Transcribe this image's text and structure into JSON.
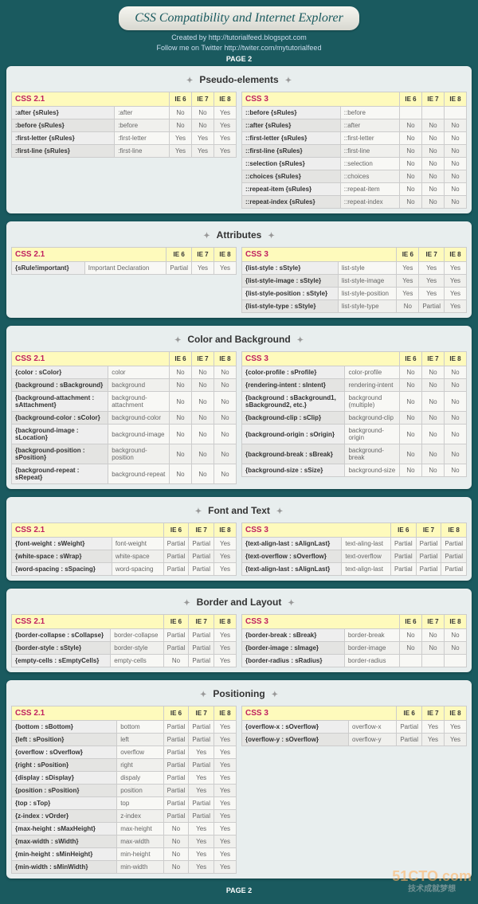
{
  "header": {
    "title": "CSS Compatibility and Internet Explorer",
    "created": "Created by http://tutorialfeed.blogspot.com",
    "follow": "Follow me on Twitter http://twiter.com/mytutorialfeed",
    "page": "PAGE 2"
  },
  "watermark": {
    "brand": "51CTO.com",
    "tag": "技术成就梦想"
  },
  "sections": [
    {
      "title": "Pseudo-elements",
      "left": {
        "spec": "CSS 2.1",
        "cols": [
          "IE 6",
          "IE 7",
          "IE 8"
        ],
        "rows": [
          {
            "a": ":after {sRules}",
            "b": ":after",
            "v": [
              "No",
              "No",
              "Yes"
            ]
          },
          {
            "a": ":before {sRules}",
            "b": ":before",
            "v": [
              "No",
              "No",
              "Yes"
            ]
          },
          {
            "a": ":first-letter {sRules}",
            "b": ":first-letter",
            "v": [
              "Yes",
              "Yes",
              "Yes"
            ]
          },
          {
            "a": ":first-line {sRules}",
            "b": ":first-line",
            "v": [
              "Yes",
              "Yes",
              "Yes"
            ]
          }
        ]
      },
      "right": {
        "spec": "CSS 3",
        "cols": [
          "IE 6",
          "IE 7",
          "IE 8"
        ],
        "rows": [
          {
            "a": "::before {sRules}",
            "b": "::before",
            "v": [
              "",
              "",
              ""
            ]
          },
          {
            "a": "::after {sRules}",
            "b": "::after",
            "v": [
              "No",
              "No",
              "No"
            ]
          },
          {
            "a": "::first-letter {sRules}",
            "b": "::first-letter",
            "v": [
              "No",
              "No",
              "No"
            ]
          },
          {
            "a": "::first-line {sRules}",
            "b": "::first-line",
            "v": [
              "No",
              "No",
              "No"
            ]
          },
          {
            "a": "::selection {sRules}",
            "b": "::selection",
            "v": [
              "No",
              "No",
              "No"
            ]
          },
          {
            "a": "::choices {sRules}",
            "b": "::choices",
            "v": [
              "No",
              "No",
              "No"
            ]
          },
          {
            "a": "::repeat-item {sRules}",
            "b": "::repeat-item",
            "v": [
              "No",
              "No",
              "No"
            ]
          },
          {
            "a": "::repeat-index {sRules}",
            "b": "::repeat-index",
            "v": [
              "No",
              "No",
              "No"
            ]
          }
        ]
      }
    },
    {
      "title": "Attributes",
      "left": {
        "spec": "CSS 2.1",
        "cols": [
          "IE 6",
          "IE 7",
          "IE 8"
        ],
        "rows": [
          {
            "a": "{sRule!important}",
            "b": "Important Declaration",
            "v": [
              "Partial",
              "Yes",
              "Yes"
            ]
          }
        ]
      },
      "right": {
        "spec": "CSS 3",
        "cols": [
          "IE 6",
          "IE 7",
          "IE 8"
        ],
        "rows": [
          {
            "a": "{list-style : sStyle}",
            "b": "list-style",
            "v": [
              "Yes",
              "Yes",
              "Yes"
            ]
          },
          {
            "a": "{list-style-image : sStyle}",
            "b": "list-style-image",
            "v": [
              "Yes",
              "Yes",
              "Yes"
            ]
          },
          {
            "a": "{list-style-position : sStyle}",
            "b": "list-style-position",
            "v": [
              "Yes",
              "Yes",
              "Yes"
            ]
          },
          {
            "a": "{list-style-type : sStyle}",
            "b": "list-style-type",
            "v": [
              "No",
              "Partial",
              "Yes"
            ]
          }
        ]
      }
    },
    {
      "title": "Color and Background",
      "left": {
        "spec": "CSS 2.1",
        "cols": [
          "IE 6",
          "IE 7",
          "IE 8"
        ],
        "rows": [
          {
            "a": "{color : sColor}",
            "b": "color",
            "v": [
              "No",
              "No",
              "No"
            ]
          },
          {
            "a": "{background : sBackground}",
            "b": "background",
            "v": [
              "No",
              "No",
              "No"
            ]
          },
          {
            "a": "{background-attachment : sAttachment}",
            "b": "background-attachment",
            "v": [
              "No",
              "No",
              "No"
            ]
          },
          {
            "a": "{background-color : sColor}",
            "b": "background-color",
            "v": [
              "No",
              "No",
              "No"
            ]
          },
          {
            "a": "{background-image : sLocation}",
            "b": "background-image",
            "v": [
              "No",
              "No",
              "No"
            ]
          },
          {
            "a": "{background-position : sPosition}",
            "b": "background-position",
            "v": [
              "No",
              "No",
              "No"
            ]
          },
          {
            "a": "{background-repeat : sRepeat}",
            "b": "background-repeat",
            "v": [
              "No",
              "No",
              "No"
            ]
          }
        ]
      },
      "right": {
        "spec": "CSS 3",
        "cols": [
          "IE 6",
          "IE 7",
          "IE 8"
        ],
        "rows": [
          {
            "a": "{color-profile : sProfile}",
            "b": "color-profile",
            "v": [
              "No",
              "No",
              "No"
            ]
          },
          {
            "a": "{rendering-intent : sIntent}",
            "b": "rendering-intent",
            "v": [
              "No",
              "No",
              "No"
            ]
          },
          {
            "a": "{background : sBackground1, sBackground2, etc.}",
            "b": "background (multiple)",
            "v": [
              "No",
              "No",
              "No"
            ]
          },
          {
            "a": "{background-clip : sClip}",
            "b": "background-clip",
            "v": [
              "No",
              "No",
              "No"
            ]
          },
          {
            "a": "{background-origin : sOrigin}",
            "b": "background-origin",
            "v": [
              "No",
              "No",
              "No"
            ]
          },
          {
            "a": "{background-break : sBreak}",
            "b": "background-break",
            "v": [
              "No",
              "No",
              "No"
            ]
          },
          {
            "a": "{background-size : sSize}",
            "b": "background-size",
            "v": [
              "No",
              "No",
              "No"
            ]
          }
        ]
      }
    },
    {
      "title": "Font and Text",
      "left": {
        "spec": "CSS 2.1",
        "cols": [
          "IE 6",
          "IE 7",
          "IE 8"
        ],
        "rows": [
          {
            "a": "{font-weight : sWeight}",
            "b": "font-weight",
            "v": [
              "Partial",
              "Partial",
              "Yes"
            ]
          },
          {
            "a": "{white-space : sWrap}",
            "b": "white-space",
            "v": [
              "Partial",
              "Partial",
              "Yes"
            ]
          },
          {
            "a": "{word-spacing : sSpacing}",
            "b": "word-spacing",
            "v": [
              "Partial",
              "Partial",
              "Yes"
            ]
          }
        ]
      },
      "right": {
        "spec": "CSS 3",
        "cols": [
          "IE 6",
          "IE 7",
          "IE 8"
        ],
        "rows": [
          {
            "a": "{text-align-last : sAlignLast}",
            "b": "text-aling-last",
            "v": [
              "Partial",
              "Partial",
              "Partial"
            ]
          },
          {
            "a": "{text-overflow : sOverflow}",
            "b": "text-overflow",
            "v": [
              "Partial",
              "Partial",
              "Partial"
            ]
          },
          {
            "a": "{text-align-last : sAlignLast}",
            "b": "text-align-last",
            "v": [
              "Partial",
              "Partial",
              "Partial"
            ]
          }
        ]
      }
    },
    {
      "title": "Border and Layout",
      "left": {
        "spec": "CSS 2.1",
        "cols": [
          "IE 6",
          "IE 7",
          "IE 8"
        ],
        "rows": [
          {
            "a": "{border-collapse : sCollapse}",
            "b": "border-collapse",
            "v": [
              "Partial",
              "Partial",
              "Yes"
            ]
          },
          {
            "a": "{border-style : sStyle}",
            "b": "border-style",
            "v": [
              "Partial",
              "Partial",
              "Yes"
            ]
          },
          {
            "a": "{empty-cells : sEmptyCells}",
            "b": "empty-cells",
            "v": [
              "No",
              "Partial",
              "Yes"
            ]
          }
        ]
      },
      "right": {
        "spec": "CSS 3",
        "cols": [
          "IE 6",
          "IE 7",
          "IE 8"
        ],
        "rows": [
          {
            "a": "{border-break : sBreak}",
            "b": "border-break",
            "v": [
              "No",
              "No",
              "No"
            ]
          },
          {
            "a": "{border-image : sImage}",
            "b": "border-image",
            "v": [
              "No",
              "No",
              "No"
            ]
          },
          {
            "a": "{border-radius : sRadius}",
            "b": "border-radius",
            "v": [
              "",
              "",
              ""
            ]
          }
        ]
      }
    },
    {
      "title": "Positioning",
      "left": {
        "spec": "CSS 2.1",
        "cols": [
          "IE 6",
          "IE 7",
          "IE 8"
        ],
        "rows": [
          {
            "a": "{bottom : sBottom}",
            "b": "bottom",
            "v": [
              "Partial",
              "Partial",
              "Yes"
            ]
          },
          {
            "a": "{left : sPosition}",
            "b": "left",
            "v": [
              "Partial",
              "Partial",
              "Yes"
            ]
          },
          {
            "a": "{overflow : sOverflow}",
            "b": "overflow",
            "v": [
              "Partial",
              "Yes",
              "Yes"
            ]
          },
          {
            "a": "{right : sPosition}",
            "b": "right",
            "v": [
              "Partial",
              "Partial",
              "Yes"
            ]
          },
          {
            "a": "{display : sDisplay}",
            "b": "dispaly",
            "v": [
              "Partial",
              "Yes",
              "Yes"
            ]
          },
          {
            "a": "{position : sPosition}",
            "b": "position",
            "v": [
              "Partial",
              "Yes",
              "Yes"
            ]
          },
          {
            "a": "{top : sTop}",
            "b": "top",
            "v": [
              "Partial",
              "Partial",
              "Yes"
            ]
          },
          {
            "a": "{z-index : vOrder}",
            "b": "z-index",
            "v": [
              "Partial",
              "Partial",
              "Yes"
            ]
          },
          {
            "a": "{max-height : sMaxHeight}",
            "b": "max-height",
            "v": [
              "No",
              "Yes",
              "Yes"
            ]
          },
          {
            "a": "{max-width : sWidth}",
            "b": "max-width",
            "v": [
              "No",
              "Yes",
              "Yes"
            ]
          },
          {
            "a": "{min-height : sMinHeight}",
            "b": "min-height",
            "v": [
              "No",
              "Yes",
              "Yes"
            ]
          },
          {
            "a": "{min-width : sMinWidth}",
            "b": "min-width",
            "v": [
              "No",
              "Yes",
              "Yes"
            ]
          }
        ]
      },
      "right": {
        "spec": "CSS 3",
        "cols": [
          "IE 6",
          "IE 7",
          "IE 8"
        ],
        "rows": [
          {
            "a": "{overflow-x : sOverflow}",
            "b": "overflow-x",
            "v": [
              "Partial",
              "Yes",
              "Yes"
            ]
          },
          {
            "a": "{overflow-y : sOverflow}",
            "b": "overflow-y",
            "v": [
              "Partial",
              "Yes",
              "Yes"
            ]
          }
        ]
      }
    }
  ]
}
